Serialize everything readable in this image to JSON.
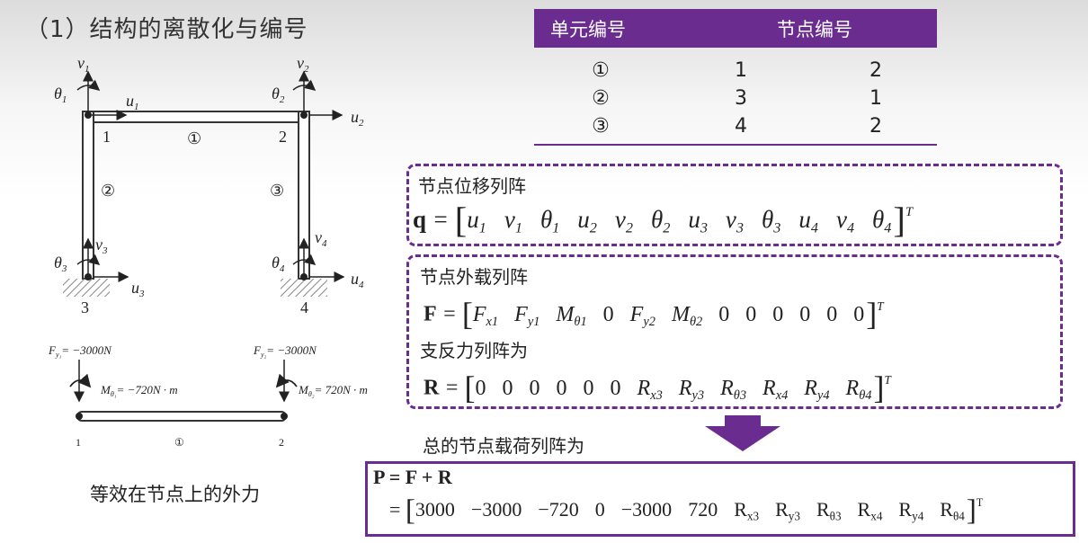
{
  "title": "（1）结构的离散化与编号",
  "table": {
    "headers": [
      "单元编号",
      "节点编号"
    ],
    "rows": [
      [
        "①",
        "1",
        "2"
      ],
      [
        "②",
        "3",
        "1"
      ],
      [
        "③",
        "4",
        "2"
      ]
    ]
  },
  "frame": {
    "node_labels": [
      "1",
      "2",
      "3",
      "4"
    ],
    "element_labels": [
      "①",
      "②",
      "③"
    ],
    "loads": {
      "fy1": "= −3000N",
      "fy2": "= −3000N",
      "m1": "= −720N · m",
      "m2": "= 720N · m"
    },
    "beam_labels": [
      "1",
      "①",
      "2"
    ],
    "caption": "等效在节点上的外力"
  },
  "q_box": {
    "label": "节点位移列阵",
    "lhs": "q",
    "entries": [
      "u1",
      "v1",
      "θ1",
      "u2",
      "v2",
      "θ2",
      "u3",
      "v3",
      "θ3",
      "u4",
      "v4",
      "θ4"
    ]
  },
  "f_box": {
    "label": "节点外载列阵",
    "lhs": "F",
    "entries": [
      "Fx1",
      "Fy1",
      "Mθ1",
      "0",
      "Fy2",
      "Mθ2",
      "0",
      "0",
      "0",
      "0",
      "0",
      "0"
    ],
    "label2": "支反力列阵为",
    "lhs2": "R",
    "entries2": [
      "0",
      "0",
      "0",
      "0",
      "0",
      "0",
      "Rx3",
      "Ry3",
      "Rθ3",
      "Rx4",
      "Ry4",
      "Rθ4"
    ]
  },
  "total": {
    "label": "总的节点载荷列阵为",
    "line1": "P = F + R",
    "entries": [
      "3000",
      "−3000",
      "−720",
      "0",
      "−3000",
      "720",
      "Rx3",
      "Ry3",
      "Rθ3",
      "Rx4",
      "Ry4",
      "Rθ4"
    ]
  },
  "colors": {
    "accent": "#6a2d8f"
  }
}
